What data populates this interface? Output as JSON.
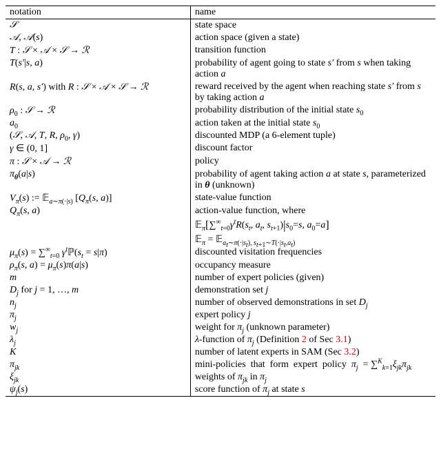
{
  "headers": {
    "notation": "notation",
    "name": "name"
  },
  "rows": [
    {
      "notation": "𝒮",
      "name": "state space"
    },
    {
      "notation": "𝒜, 𝒜(s)",
      "name": "action space (given a state)"
    },
    {
      "notation": "T : 𝒮 × 𝒜 × 𝒮 → ℛ",
      "name": "transition function"
    },
    {
      "notation": "T(s′|s, a)",
      "name": "probability of agent going to state s′ from s when taking action a"
    },
    {
      "notation": "R(s, a, s′) with R : 𝒮 × 𝒜 × 𝒮 → ℛ",
      "name": "reward received by the agent when reaching state s′ from s by taking action a"
    },
    {
      "notation": "ρ₀ : 𝒮 → ℛ",
      "name": "probability distribution of the initial state s₀"
    },
    {
      "notation": "a₀",
      "name": "action taken at the initial state s₀"
    },
    {
      "notation": "(𝒮, 𝒜, T, R, ρ₀, γ)",
      "name": "discounted MDP (a 6-element tuple)"
    },
    {
      "notation": "γ ∈ (0, 1]",
      "name": "discount factor"
    },
    {
      "notation": "π : 𝒮 × 𝒜 → ℛ",
      "name": "policy"
    },
    {
      "notation": "π_𝜽(a|s)",
      "name": "probability of agent taking action a at state s, parameterized in 𝜽 (unknown)"
    },
    {
      "notation": "V_π(s) := 𝔼_{a∼π(·|s)} [Q_π(s, a)]",
      "name": "state-value function"
    },
    {
      "notation": "Q_π(s, a)",
      "name": "action-value function, where"
    },
    {
      "notation": "",
      "name": "𝔼_π[∑_{t=0}^∞ γ^t R(s_t, a_t, s_{t+1}) | s₀=s, a₀=a]"
    },
    {
      "notation": "",
      "name": "𝔼_π = 𝔼_{a_t∼π(·|s_t), s_{t+1}∼T(·|s_t,a_t)}"
    },
    {
      "notation": "μ_π(s) = ∑_{t=0}^∞ γ^t ℙ(s_t = s|π)",
      "name": "discounted visitation frequencies"
    },
    {
      "notation": "ρ_π(s, a) = μ_π(s)π(a|s)",
      "name": "occupancy measure"
    },
    {
      "notation": "m",
      "name": "number of expert policies (given)"
    },
    {
      "notation": "D_j for j = 1, …, m",
      "name": "demonstration set j"
    },
    {
      "notation": "n_j",
      "name": "number of observed demonstrations in set D_j"
    },
    {
      "notation": "π_j",
      "name": "expert policy j"
    },
    {
      "notation": "w_j",
      "name": "weight for π_j (unknown parameter)"
    },
    {
      "notation": "λ_j",
      "name": "λ-function of π_j (Definition 2 of Sec 3.1)"
    },
    {
      "notation": "K",
      "name": "number of latent experts in SAM (Sec 3.2)"
    },
    {
      "notation": "π_{jk}",
      "name": "mini-policies that form expert policy π_j = ∑_{k=1}^K ξ_{jk} π_{jk}"
    },
    {
      "notation": "ξ_{jk}",
      "name": "weights of π_{jk} in π_j"
    },
    {
      "notation": "ψ_j(s)",
      "name": "score function of π_j at state s"
    }
  ],
  "links": {
    "def2": "2",
    "sec31": "3.1",
    "sec32": "3.2"
  }
}
